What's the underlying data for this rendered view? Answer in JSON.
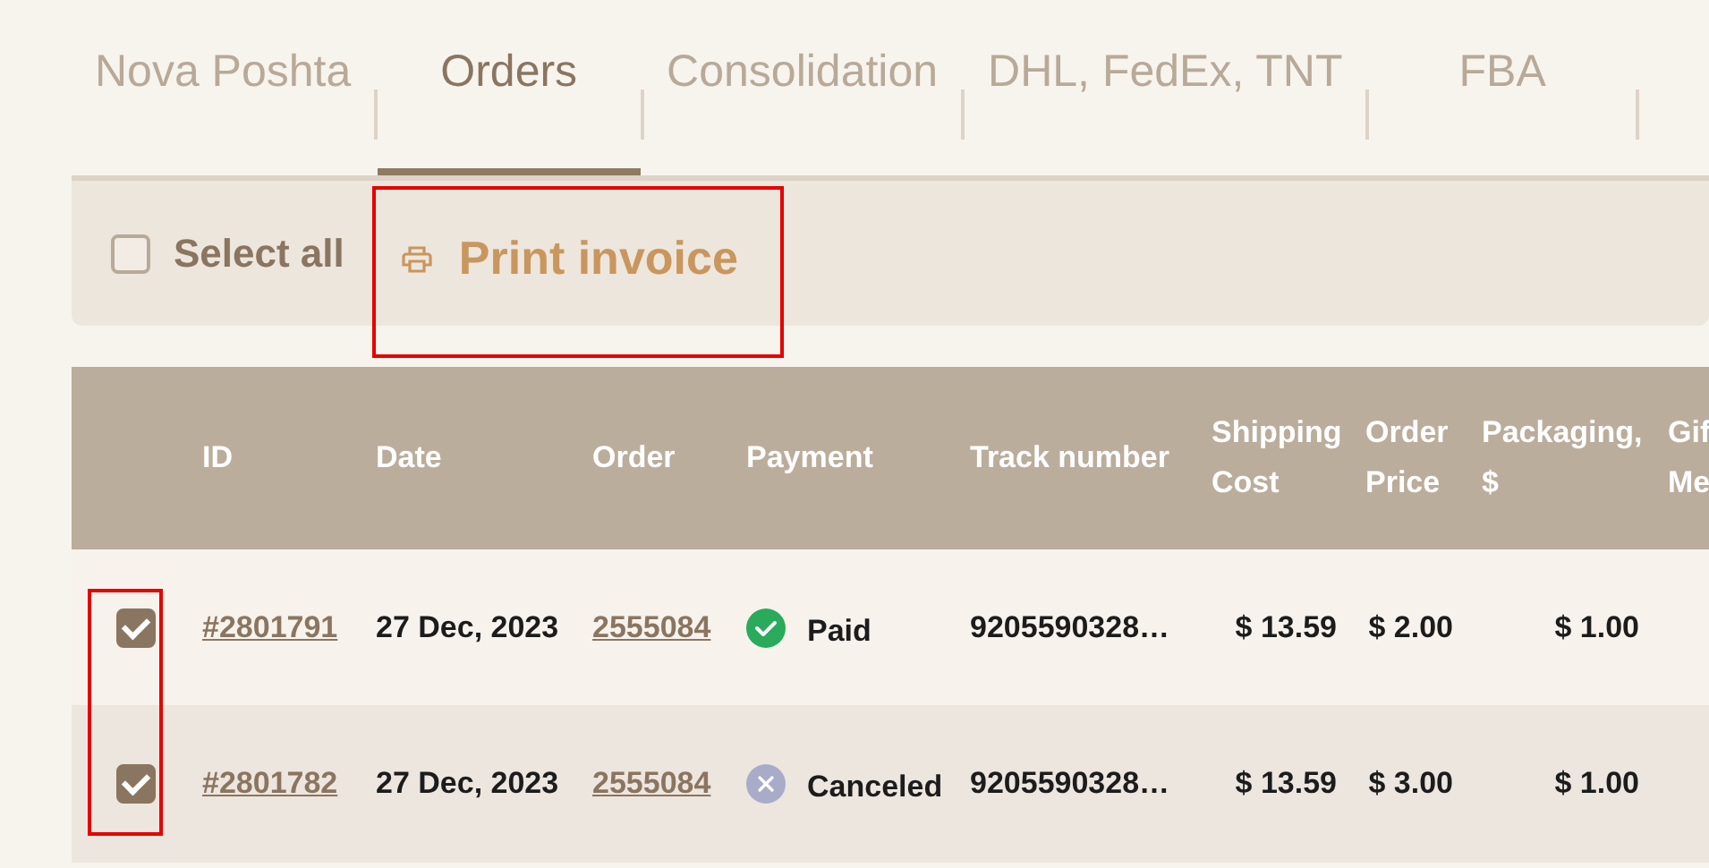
{
  "tabs": [
    {
      "label": "Nova Poshta",
      "selected": false
    },
    {
      "label": "Orders",
      "selected": true
    },
    {
      "label": "Consolidation",
      "selected": false
    },
    {
      "label": "DHL, FedEx, TNT",
      "selected": false
    },
    {
      "label": "FBA",
      "selected": false
    }
  ],
  "toolbar": {
    "select_all": {
      "label": "Select all",
      "checked": false
    },
    "print_button": {
      "label": "Print invoice",
      "highlighted": true
    }
  },
  "table": {
    "columns": [
      "ID",
      "Date",
      "Order",
      "Payment",
      "Track number",
      "Shipping Cost",
      "Order Price",
      "Packaging, $",
      "Gif Me"
    ],
    "checkboxes_highlighted": true,
    "rows": [
      {
        "checked": true,
        "id": "#2801791",
        "date": "27 Dec, 2023",
        "order": "2555084",
        "payment": {
          "kind": "paid",
          "label": "Paid"
        },
        "track": "9205590328…",
        "shipping": "$ 13.59",
        "price": "$ 2.00",
        "packaging": "$ 1.00"
      },
      {
        "checked": true,
        "id": "#2801782",
        "date": "27 Dec, 2023",
        "order": "2555084",
        "payment": {
          "kind": "canceled",
          "label": "Canceled"
        },
        "track": "9205590328…",
        "shipping": "$ 13.59",
        "price": "$ 3.00",
        "packaging": "$ 1.00"
      }
    ]
  }
}
